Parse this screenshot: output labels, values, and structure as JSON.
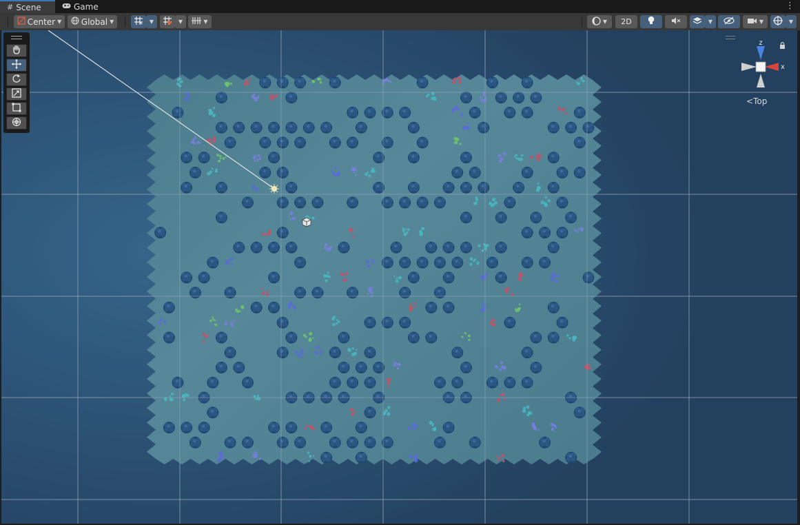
{
  "tabs": [
    {
      "label": "Scene",
      "icon": "grid-icon"
    },
    {
      "label": "Game",
      "icon": "gamepad-icon"
    }
  ],
  "toolbar": {
    "pivot_label": "Center",
    "space_label": "Global",
    "mode_2d_label": "2D"
  },
  "tools": [
    "hand-tool",
    "move-tool",
    "rotate-tool",
    "scale-tool",
    "rect-tool",
    "transform-tool"
  ],
  "gizmo": {
    "axis_z": "z",
    "axis_x": "x",
    "view_label": "Top"
  },
  "colors": {
    "accent": "#46607c",
    "viewport_bg": "#264468",
    "ground": "#4f8394",
    "x_axis": "#d9453a",
    "z_axis": "#4a84e0"
  }
}
